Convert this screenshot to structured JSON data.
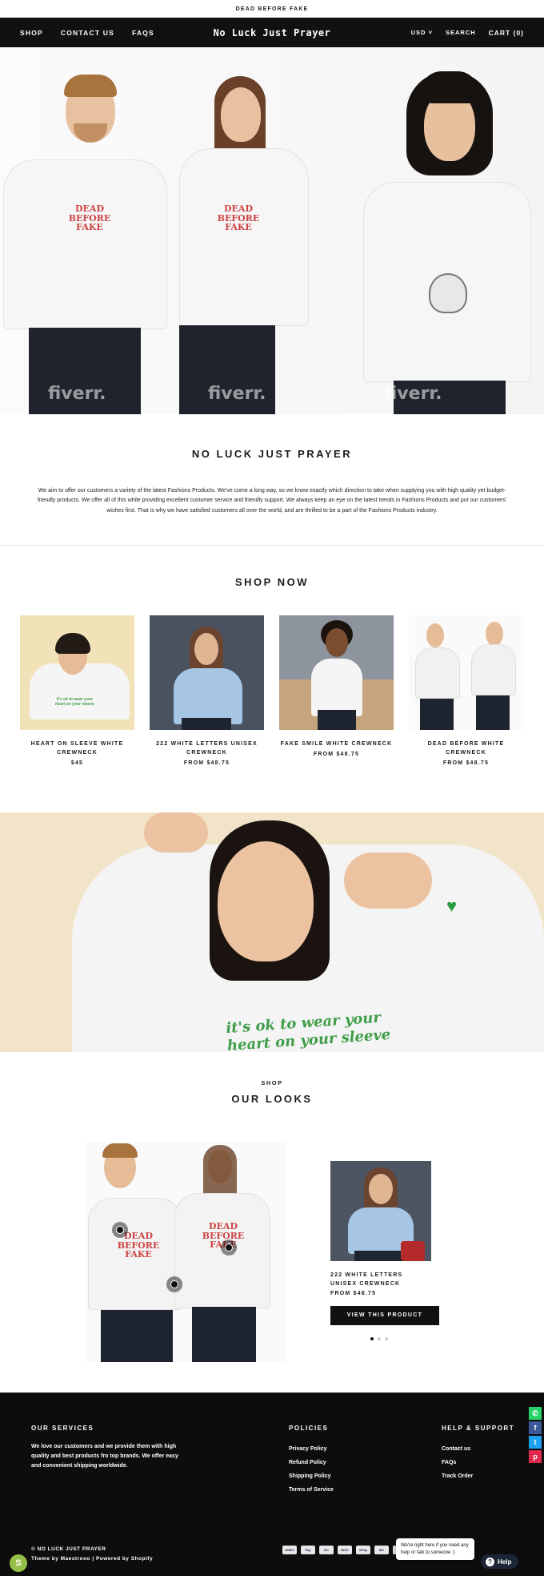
{
  "announcement": "DEAD BEFORE FAKE",
  "header": {
    "nav_left": [
      "SHOP",
      "CONTACT US",
      "FAQS"
    ],
    "logo": "No Luck Just Prayer",
    "currency": "USD",
    "search": "SEARCH",
    "cart": "CART (0)"
  },
  "hero": {
    "print_text": "DEAD BEFORE FAKE",
    "watermark": "fiverr."
  },
  "about": {
    "title": "NO LUCK JUST PRAYER",
    "text": "We aim to offer our customers a variety of the latest Fashions Products. We've come a long way, so we know exactly which direction to take when supplying you with high quality yet budget-friendly products. We offer all of this while providing excellent customer service and friendly support. We always keep an eye on the latest trends in Fashions Products and put our customers' wishes first. That is why we have satisfied customers all over the world, and are thrilled to be a part of the Fashions Products industry."
  },
  "shop_now": {
    "title": "SHOP NOW",
    "products": [
      {
        "title": "HEART ON SLEEVE WHITE CREWNECK",
        "price": "$45"
      },
      {
        "title": "222 WHITE LETTERS UNISEX CREWNECK",
        "price": "FROM $48.75"
      },
      {
        "title": "FAKE SMILE WHITE CREWNECK",
        "price": "FROM $48.75"
      },
      {
        "title": "DEAD BEFORE WHITE CREWNECK",
        "price": "FROM $48.75"
      }
    ]
  },
  "banner": {
    "slogan_line1": "it's ok to wear your",
    "slogan_line2": "heart on your sleeve"
  },
  "looks": {
    "subtitle": "SHOP",
    "title": "OUR LOOKS",
    "card": {
      "title": "222 WHITE LETTERS UNISEX CREWNECK",
      "price": "FROM $48.75",
      "button": "VIEW THIS PRODUCT"
    }
  },
  "footer": {
    "services_title": "OUR SERVICES",
    "services_text": "We love our customers and we provide them with high quality and best products fro top brands. We offer easy and convenient shipping worldwide.",
    "policies_title": "POLICIES",
    "policies": [
      "Privacy Policy",
      "Refund Policy",
      "Shipping Policy",
      "Terms of Service"
    ],
    "help_title": "HELP & SUPPORT",
    "help": [
      "Contact us",
      "FAQs",
      "Track Order"
    ],
    "copyright": "© NO LUCK JUST PRAYER",
    "credits": "Theme by Maestrooo | Powered by Shopify",
    "payments": [
      "AMEX",
      "Pay",
      "DC",
      "DISC",
      "GPay",
      "MC",
      "PP",
      "SPay",
      "V",
      "VISA"
    ]
  },
  "social": {
    "colors": [
      "#25d366",
      "#3b5998",
      "#1da1f2",
      "#e02a4d"
    ]
  },
  "chat": {
    "bubble": "We're right here if you need any help or talk to someone :)",
    "help": "Help"
  }
}
